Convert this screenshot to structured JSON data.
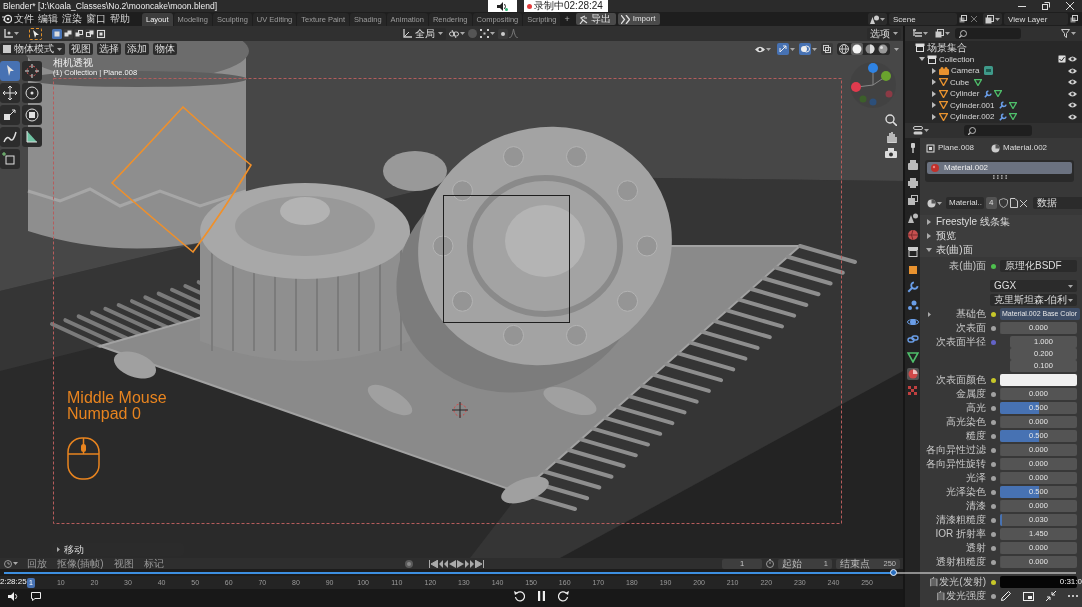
{
  "title_bar": {
    "title": "Blender* [J:\\Koala_Classes\\No.2\\mooncake\\moon.blend]",
    "recording": "录制中02:28:24"
  },
  "menu_bar": {
    "menus": [
      "文件",
      "编辑",
      "渲染",
      "窗口",
      "帮助"
    ],
    "workspaces": [
      {
        "label": "Layout",
        "selected": true
      },
      {
        "label": "Modeling",
        "selected": false
      },
      {
        "label": "Sculpting",
        "selected": false
      },
      {
        "label": "UV Editing",
        "selected": false
      },
      {
        "label": "Texture Paint",
        "selected": false
      },
      {
        "label": "Shading",
        "selected": false
      },
      {
        "label": "Animation",
        "selected": false
      },
      {
        "label": "Rendering",
        "selected": false
      },
      {
        "label": "Compositing",
        "selected": false
      },
      {
        "label": "Scripting",
        "selected": false
      }
    ],
    "add_workspace": "+",
    "addon_buttons": [
      {
        "kind": "export",
        "label": "导出"
      },
      {
        "kind": "import",
        "label": "Import"
      }
    ],
    "scene": "Scene",
    "view_layer": "View Layer"
  },
  "viewport_header": {
    "select_modes": [
      {
        "kind": "new",
        "selected": true
      },
      {
        "kind": "extend",
        "selected": false
      },
      {
        "kind": "subtract",
        "selected": false
      },
      {
        "kind": "difference",
        "selected": false
      },
      {
        "kind": "intersect",
        "selected": false
      }
    ],
    "orientation": "全局",
    "options": "选项",
    "mode": "物体模式",
    "menus": [
      "视图",
      "选择",
      "添加",
      "物体"
    ],
    "toggles": [
      {
        "kind": "gizmo",
        "on": true
      },
      {
        "kind": "overlay",
        "on": true
      },
      {
        "kind": "xray",
        "on": false
      }
    ],
    "shading_modes": [
      {
        "kind": "wireframe",
        "selected": false
      },
      {
        "kind": "solid",
        "selected": true
      },
      {
        "kind": "material",
        "selected": false
      },
      {
        "kind": "rendered",
        "selected": false
      }
    ]
  },
  "viewport": {
    "tools": [
      {
        "kind": "select",
        "selected": true
      },
      {
        "kind": "cursor",
        "selected": false
      },
      {
        "kind": "move",
        "selected": false
      },
      {
        "kind": "rotate",
        "selected": false
      },
      {
        "kind": "scale",
        "selected": false
      },
      {
        "kind": "transform",
        "selected": false
      },
      {
        "kind": "annotate",
        "selected": false
      },
      {
        "kind": "measure",
        "selected": false
      },
      {
        "kind": "add_cube",
        "selected": false
      }
    ],
    "view_name": "相机透视",
    "object_info": "(1) Collection | Plane.008",
    "key_hints": [
      "Middle Mouse",
      "Numpad 0"
    ],
    "operator_panel": "移动"
  },
  "timeline": {
    "menus": [
      "回放",
      "抠像(插帧)",
      "视图",
      "标记"
    ],
    "current_frame": "1",
    "start_label": "起始",
    "start_frame": "1",
    "end_label": "结束点",
    "end_frame": "250",
    "ruler": [
      {
        "label": "1",
        "selected": true
      },
      {
        "label": "10",
        "selected": false
      },
      {
        "label": "20",
        "selected": false
      },
      {
        "label": "30",
        "selected": false
      },
      {
        "label": "40",
        "selected": false
      },
      {
        "label": "50",
        "selected": false
      },
      {
        "label": "60",
        "selected": false
      },
      {
        "label": "70",
        "selected": false
      },
      {
        "label": "80",
        "selected": false
      },
      {
        "label": "90",
        "selected": false
      },
      {
        "label": "100",
        "selected": false
      },
      {
        "label": "110",
        "selected": false
      },
      {
        "label": "120",
        "selected": false
      },
      {
        "label": "130",
        "selected": false
      },
      {
        "label": "140",
        "selected": false
      },
      {
        "label": "150",
        "selected": false
      },
      {
        "label": "160",
        "selected": false
      },
      {
        "label": "170",
        "selected": false
      },
      {
        "label": "180",
        "selected": false
      },
      {
        "label": "190",
        "selected": false
      },
      {
        "label": "200",
        "selected": false
      },
      {
        "label": "210",
        "selected": false
      },
      {
        "label": "220",
        "selected": false
      },
      {
        "label": "230",
        "selected": false
      },
      {
        "label": "240",
        "selected": false
      },
      {
        "label": "250",
        "selected": false
      }
    ]
  },
  "outliner": {
    "tree": [
      {
        "label": "场景集合",
        "kind": "scene_collection",
        "children": [
          {
            "label": "Collection",
            "kind": "collection",
            "expanded": true,
            "checked": true,
            "children": [
              {
                "label": "Camera",
                "kind": "camera",
                "expanded": false
              },
              {
                "label": "Cube",
                "kind": "mesh",
                "expanded": false
              },
              {
                "label": "Cylinder",
                "kind": "modified_mesh",
                "expanded": false
              },
              {
                "label": "Cylinder.001",
                "kind": "modified_mesh",
                "expanded": false
              },
              {
                "label": "Cylinder.002",
                "kind": "modified_mesh",
                "expanded": false
              }
            ]
          }
        ]
      }
    ]
  },
  "properties": {
    "tabs": [
      {
        "kind": "tool",
        "selected": false
      },
      {
        "kind": "render",
        "selected": false
      },
      {
        "kind": "output",
        "selected": false
      },
      {
        "kind": "view_layer",
        "selected": false
      },
      {
        "kind": "scene",
        "selected": false
      },
      {
        "kind": "world",
        "selected": false
      },
      {
        "kind": "collection",
        "selected": false
      },
      {
        "kind": "object",
        "selected": false
      },
      {
        "kind": "modifiers",
        "selected": false
      },
      {
        "kind": "particles",
        "selected": false
      },
      {
        "kind": "physics",
        "selected": false
      },
      {
        "kind": "constraints",
        "selected": false
      },
      {
        "kind": "data",
        "selected": false
      },
      {
        "kind": "material",
        "selected": true
      },
      {
        "kind": "texture",
        "selected": false
      }
    ],
    "breadcrumb": [
      "Plane.008",
      "Material.002"
    ],
    "material_slots": [
      {
        "label": "Material.002",
        "selected": true
      }
    ],
    "material_name": "Material..",
    "user_count": "4",
    "link_mode": "数据",
    "panels": [
      {
        "title": "Freestyle 线条集",
        "expanded": false
      },
      {
        "title": "预览",
        "expanded": false
      },
      {
        "title": "表(曲)面",
        "expanded": true,
        "surface_label": "表(曲)面",
        "shader": "原理化BSDF",
        "dropdowns": [
          "GGX",
          "克里斯坦森-伯利"
        ],
        "inputs": [
          {
            "kind": "link",
            "label": "基础色",
            "color": "#c7c729",
            "value": "Material.002 Base Color"
          },
          {
            "kind": "slider",
            "label": "次表面",
            "color": "#a1a1a1",
            "value": "0.000",
            "level": 0
          },
          {
            "kind": "vector",
            "label": "次表面半径",
            "color": "#6363c7",
            "values": [
              "1.000",
              "0.200",
              "0.100"
            ]
          },
          {
            "kind": "color",
            "label": "次表面颜色",
            "color": "#c7c729",
            "swatch": {
              "color": "#f0f0f0"
            }
          },
          {
            "kind": "slider",
            "label": "金属度",
            "color": "#a1a1a1",
            "value": "0.000",
            "level": 0
          },
          {
            "kind": "slider",
            "label": "高光",
            "color": "#a1a1a1",
            "value": "0.500",
            "level": 0.5
          },
          {
            "kind": "slider",
            "label": "高光染色",
            "color": "#a1a1a1",
            "value": "0.000",
            "level": 0
          },
          {
            "kind": "slider",
            "label": "糙度",
            "color": "#a1a1a1",
            "value": "0.500",
            "level": 0.5
          },
          {
            "kind": "slider",
            "label": "各向异性过滤",
            "color": "#a1a1a1",
            "value": "0.000",
            "level": 0
          },
          {
            "kind": "slider",
            "label": "各向异性旋转",
            "color": "#a1a1a1",
            "value": "0.000",
            "level": 0
          },
          {
            "kind": "slider",
            "label": "光泽",
            "color": "#a1a1a1",
            "value": "0.000",
            "level": 0
          },
          {
            "kind": "slider",
            "label": "光泽染色",
            "color": "#a1a1a1",
            "value": "0.500",
            "level": 0.5
          },
          {
            "kind": "slider",
            "label": "清漆",
            "color": "#a1a1a1",
            "value": "0.000",
            "level": 0
          },
          {
            "kind": "slider",
            "label": "清漆粗糙度",
            "color": "#a1a1a1",
            "value": "0.030",
            "level": 0.03
          },
          {
            "kind": "number",
            "label": "IOR 折射率",
            "color": "#a1a1a1",
            "value": "1.450"
          },
          {
            "kind": "slider",
            "label": "透射",
            "color": "#a1a1a1",
            "value": "0.000",
            "level": 0
          },
          {
            "kind": "slider",
            "label": "透射粗糙度",
            "color": "#a1a1a1",
            "value": "0.000",
            "level": 0
          },
          {
            "kind": "color",
            "label": "自发光(发射)",
            "color": "#c7c729",
            "swatch": {
              "color": "#050505"
            }
          },
          {
            "kind": "number",
            "label": "自发光强度",
            "color": "#a1a1a1"
          }
        ]
      }
    ]
  },
  "video_player": {
    "level": 0.83,
    "current_time": "2:28:25",
    "end_time": "0:31:0"
  }
}
